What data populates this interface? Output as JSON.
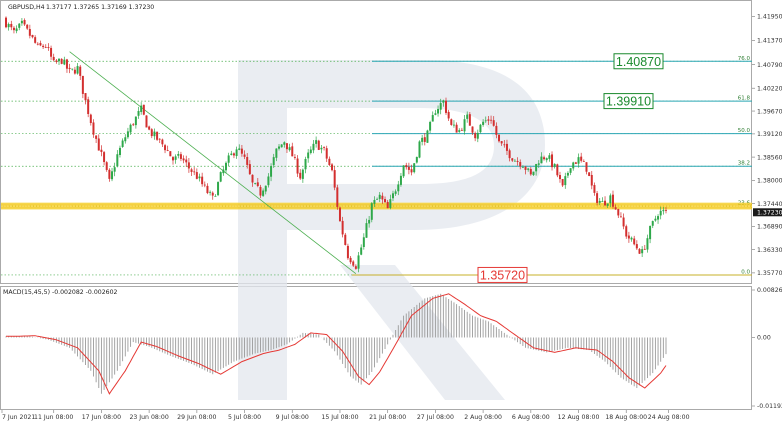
{
  "header": {
    "symbol": "GBPUSD,H4",
    "ohlc": "1.37177 1.37265 1.37169 1.37230",
    "macd_label": "MACD(15,45,5) -0.002082 -0.002602"
  },
  "colors": {
    "bull": "#2ea84a",
    "bear": "#d32f2f",
    "fib_line": "#2aa6b4",
    "fib_dotted": "#4caf50",
    "support_zone": "#f2c200",
    "trend_line": "#4caf50",
    "macd_signal": "#e53935",
    "macd_hist": "#9a9a9a",
    "watermark": "#e3e7ee"
  },
  "price_axis": {
    "ticks": [
      "1.41950",
      "1.41370",
      "1.40790",
      "1.40220",
      "1.39670",
      "1.39120",
      "1.38560",
      "1.38000",
      "1.37440",
      "1.36890",
      "1.36330",
      "1.35770"
    ],
    "current_price": "1.37230"
  },
  "macd_axis": {
    "ticks": [
      "0.008264",
      "0.00",
      "-0.01193"
    ]
  },
  "time_axis": {
    "labels": [
      "7 Jun 2021",
      "11 Jun 08:00",
      "17 Jun 08:00",
      "23 Jun 08:00",
      "29 Jun 08:00",
      "5 Jul 08:00",
      "9 Jul 08:00",
      "15 Jul 08:00",
      "21 Jul 08:00",
      "27 Jul 08:00",
      "2 Aug 08:00",
      "6 Aug 08:00",
      "12 Aug 08:00",
      "18 Aug 08:00",
      "24 Aug 08:00"
    ]
  },
  "fibonacci": {
    "levels": [
      {
        "pct": "76.0",
        "price": 1.4087
      },
      {
        "pct": "61.8",
        "price": 1.3991
      },
      {
        "pct": "50.0",
        "price": 1.39125
      },
      {
        "pct": "38.2",
        "price": 1.3834
      },
      {
        "pct": "23.6",
        "price": 1.3738
      },
      {
        "pct": "0.0",
        "price": 1.3572
      }
    ],
    "callouts": [
      {
        "text": "1.40870",
        "price": 1.4087,
        "color": "#1b8a2e"
      },
      {
        "text": "1.39910",
        "price": 1.3991,
        "color": "#1b8a2e"
      },
      {
        "text": "1.35720",
        "price": 1.3572,
        "color": "#e53935"
      }
    ],
    "support_price": 1.3738
  },
  "chart_data": {
    "type": "candlestick",
    "price_ylim": [
      1.3555,
      1.4225
    ],
    "macd_ylim": [
      -0.01193,
      0.008264
    ],
    "close_path": [
      [
        0,
        1.418
      ],
      [
        3,
        1.4155
      ],
      [
        6,
        1.4175
      ],
      [
        9,
        1.415
      ],
      [
        12,
        1.412
      ],
      [
        15,
        1.4125
      ],
      [
        18,
        1.408
      ],
      [
        21,
        1.409
      ],
      [
        24,
        1.406
      ],
      [
        27,
        1.407
      ],
      [
        30,
        1.399
      ],
      [
        33,
        1.392
      ],
      [
        36,
        1.386
      ],
      [
        39,
        1.3795
      ],
      [
        42,
        1.386
      ],
      [
        45,
        1.3905
      ],
      [
        48,
        1.394
      ],
      [
        51,
        1.397
      ],
      [
        54,
        1.392
      ],
      [
        57,
        1.39
      ],
      [
        60,
        1.388
      ],
      [
        63,
        1.385
      ],
      [
        66,
        1.3855
      ],
      [
        69,
        1.383
      ],
      [
        72,
        1.381
      ],
      [
        75,
        1.378
      ],
      [
        78,
        1.3755
      ],
      [
        81,
        1.381
      ],
      [
        84,
        1.385
      ],
      [
        87,
        1.388
      ],
      [
        90,
        1.385
      ],
      [
        93,
        1.379
      ],
      [
        96,
        1.377
      ],
      [
        99,
        1.381
      ],
      [
        102,
        1.387
      ],
      [
        105,
        1.3895
      ],
      [
        108,
        1.386
      ],
      [
        111,
        1.381
      ],
      [
        114,
        1.386
      ],
      [
        117,
        1.389
      ],
      [
        120,
        1.387
      ],
      [
        123,
        1.382
      ],
      [
        126,
        1.37
      ],
      [
        129,
        1.362
      ],
      [
        132,
        1.3595
      ],
      [
        135,
        1.366
      ],
      [
        138,
        1.374
      ],
      [
        141,
        1.376
      ],
      [
        144,
        1.373
      ],
      [
        147,
        1.378
      ],
      [
        150,
        1.384
      ],
      [
        153,
        1.382
      ],
      [
        156,
        1.389
      ],
      [
        159,
        1.391
      ],
      [
        162,
        1.397
      ],
      [
        165,
        1.399
      ],
      [
        168,
        1.393
      ],
      [
        171,
        1.392
      ],
      [
        174,
        1.395
      ],
      [
        177,
        1.391
      ],
      [
        180,
        1.394
      ],
      [
        183,
        1.395
      ],
      [
        186,
        1.389
      ],
      [
        189,
        1.387
      ],
      [
        192,
        1.385
      ],
      [
        195,
        1.384
      ],
      [
        198,
        1.381
      ],
      [
        201,
        1.385
      ],
      [
        204,
        1.386
      ],
      [
        207,
        1.383
      ],
      [
        210,
        1.378
      ],
      [
        213,
        1.384
      ],
      [
        216,
        1.385
      ],
      [
        219,
        1.383
      ],
      [
        222,
        1.376
      ],
      [
        225,
        1.3745
      ],
      [
        228,
        1.376
      ],
      [
        231,
        1.372
      ],
      [
        234,
        1.367
      ],
      [
        237,
        1.3645
      ],
      [
        240,
        1.3625
      ],
      [
        243,
        1.368
      ],
      [
        246,
        1.3723
      ],
      [
        249,
        1.3723
      ]
    ],
    "macd_path": [
      [
        0,
        0.0002
      ],
      [
        8,
        0.0003
      ],
      [
        16,
        -0.0004
      ],
      [
        24,
        -0.0018
      ],
      [
        32,
        -0.0058
      ],
      [
        36,
        -0.0098
      ],
      [
        42,
        -0.0058
      ],
      [
        48,
        -0.0008
      ],
      [
        54,
        -0.0016
      ],
      [
        62,
        -0.0032
      ],
      [
        70,
        -0.0046
      ],
      [
        78,
        -0.0064
      ],
      [
        86,
        -0.0042
      ],
      [
        94,
        -0.0028
      ],
      [
        100,
        -0.0022
      ],
      [
        106,
        -0.0012
      ],
      [
        112,
        0.0008
      ],
      [
        118,
        0.0005
      ],
      [
        124,
        -0.0024
      ],
      [
        130,
        -0.0068
      ],
      [
        134,
        -0.0082
      ],
      [
        138,
        -0.006
      ],
      [
        144,
        -0.0012
      ],
      [
        150,
        0.0038
      ],
      [
        158,
        0.0068
      ],
      [
        164,
        0.0076
      ],
      [
        170,
        0.0058
      ],
      [
        176,
        0.0038
      ],
      [
        182,
        0.0028
      ],
      [
        188,
        0.0008
      ],
      [
        196,
        -0.0018
      ],
      [
        204,
        -0.0026
      ],
      [
        212,
        -0.0018
      ],
      [
        220,
        -0.0022
      ],
      [
        226,
        -0.0042
      ],
      [
        232,
        -0.007
      ],
      [
        238,
        -0.0088
      ],
      [
        244,
        -0.0062
      ],
      [
        249,
        -0.0029
      ]
    ]
  }
}
